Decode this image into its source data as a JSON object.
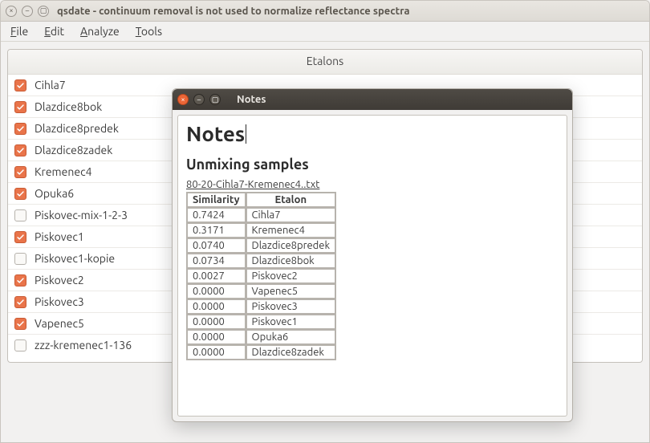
{
  "main": {
    "title": "qsdate - continuum removal is not used to normalize reflectance spectra",
    "menu": {
      "file": "File",
      "edit": "Edit",
      "analyze": "Analyze",
      "tools": "Tools"
    },
    "etalons_header": "Etalons",
    "etalons": [
      {
        "label": "Cihla7",
        "checked": true
      },
      {
        "label": "Dlazdice8bok",
        "checked": true
      },
      {
        "label": "Dlazdice8predek",
        "checked": true
      },
      {
        "label": "Dlazdice8zadek",
        "checked": true
      },
      {
        "label": "Kremenec4",
        "checked": true
      },
      {
        "label": "Opuka6",
        "checked": true
      },
      {
        "label": "Piskovec-mix-1-2-3",
        "checked": false
      },
      {
        "label": "Piskovec1",
        "checked": true
      },
      {
        "label": "Piskovec1-kopie",
        "checked": false
      },
      {
        "label": "Piskovec2",
        "checked": true
      },
      {
        "label": "Piskovec3",
        "checked": true
      },
      {
        "label": "Vapenec5",
        "checked": true
      },
      {
        "label": "zzz-kremenec1-136",
        "checked": false
      }
    ]
  },
  "notes": {
    "window_title": "Notes",
    "h1": "Notes",
    "h2": "Unmixing samples",
    "filename": "80-20-Cihla7-Kremenec4..txt",
    "table": {
      "headers": {
        "similarity": "Similarity",
        "etalon": "Etalon"
      },
      "rows": [
        {
          "sim": "0.7424",
          "etalon": "Cihla7"
        },
        {
          "sim": "0.3171",
          "etalon": "Kremenec4"
        },
        {
          "sim": "0.0740",
          "etalon": "Dlazdice8predek"
        },
        {
          "sim": "0.0734",
          "etalon": "Dlazdice8bok"
        },
        {
          "sim": "0.0027",
          "etalon": "Piskovec2"
        },
        {
          "sim": "0.0000",
          "etalon": "Vapenec5"
        },
        {
          "sim": "0.0000",
          "etalon": "Piskovec3"
        },
        {
          "sim": "0.0000",
          "etalon": "Piskovec1"
        },
        {
          "sim": "0.0000",
          "etalon": "Opuka6"
        },
        {
          "sim": "0.0000",
          "etalon": "Dlazdice8zadek"
        }
      ]
    }
  }
}
